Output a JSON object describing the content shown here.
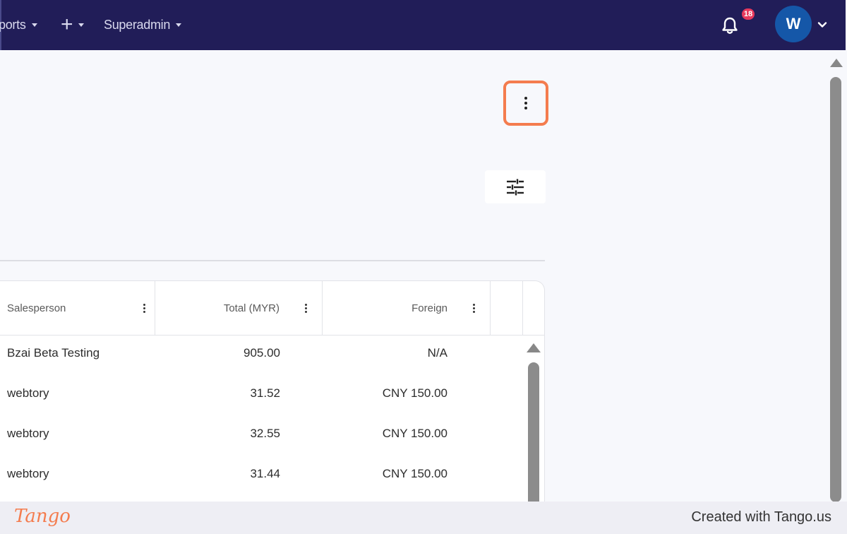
{
  "topnav": {
    "reports_label": "ports",
    "add_label": "+",
    "superadmin_label": "Superadmin",
    "notification_count": "18",
    "avatar_initial": "W"
  },
  "toolbar": {
    "more_icon": "kebab-vertical-icon",
    "filter_icon": "tune-sliders-icon"
  },
  "table": {
    "columns": [
      {
        "label": "Salesperson"
      },
      {
        "label": "Total (MYR)"
      },
      {
        "label": "Foreign"
      }
    ],
    "rows": [
      {
        "salesperson": "Bzai Beta Testing",
        "total": "905.00",
        "foreign": "N/A"
      },
      {
        "salesperson": "webtory",
        "total": "31.52",
        "foreign": "CNY 150.00"
      },
      {
        "salesperson": "webtory",
        "total": "32.55",
        "foreign": "CNY 150.00"
      },
      {
        "salesperson": "webtory",
        "total": "31.44",
        "foreign": "CNY 150.00"
      }
    ]
  },
  "footer": {
    "logo": "Tango",
    "credit": "Created with Tango.us"
  },
  "colors": {
    "nav_bg": "#211d58",
    "highlight": "#f47c4e",
    "badge": "#e7395d",
    "avatar": "#1557a8"
  }
}
